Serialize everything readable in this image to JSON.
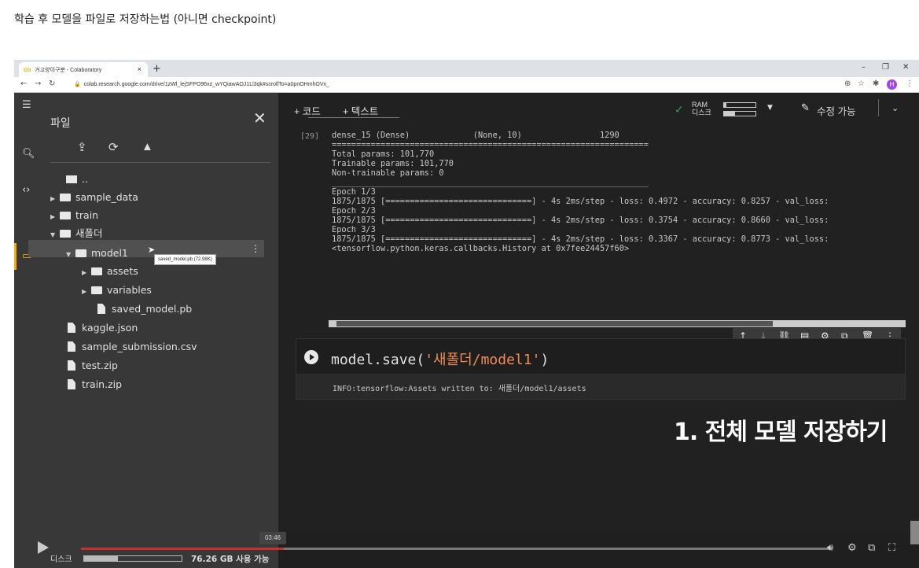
{
  "heading": "학습 후 모델을 파일로 저장하는법 (아니면 checkpoint)",
  "browser": {
    "tab_title": "거고양이구분 - Colaboratory",
    "tab_close": "×",
    "new_tab": "+",
    "url": "colab.research.google.com/drive/1zWl_lejSFPO96xz_wYQiawAOJ1Ll3qk#scrollTo=a0pnOHmhOVx_",
    "avatar": "H"
  },
  "sidebar": {
    "title": "파일",
    "close": "✕",
    "tree": [
      {
        "label": "..",
        "type": "up"
      },
      {
        "label": "sample_data",
        "type": "folder"
      },
      {
        "label": "train",
        "type": "folder"
      },
      {
        "label": "새폴더",
        "type": "folder-open"
      },
      {
        "label": "model1",
        "type": "folder-open"
      },
      {
        "label": "assets",
        "type": "folder"
      },
      {
        "label": "variables",
        "type": "folder"
      },
      {
        "label": "saved_model.pb",
        "type": "file"
      },
      {
        "label": "kaggle.json",
        "type": "file"
      },
      {
        "label": "sample_submission.csv",
        "type": "file"
      },
      {
        "label": "test.zip",
        "type": "file"
      },
      {
        "label": "train.zip",
        "type": "file"
      }
    ],
    "tooltip": "saved_model.pb (72.98K)",
    "disk_label": "디스크",
    "disk_free": "76.26 GB 사용 가능",
    "disk_used_fraction": 0.35
  },
  "toolbar": {
    "add_code": "+ 코드",
    "add_text": "+ 텍스트",
    "ram": "RAM",
    "disk": "디스크",
    "edit": "수정 가능"
  },
  "output": {
    "exec_count": "[29]",
    "lines": "dense_15 (Dense)             (None, 10)                1290\n=================================================================\nTotal params: 101,770\nTrainable params: 101,770\nNon-trainable params: 0\n_________________________________________________________________\nEpoch 1/3\n1875/1875 [==============================] - 4s 2ms/step - loss: 0.4972 - accuracy: 0.8257 - val_loss:\nEpoch 2/3\n1875/1875 [==============================] - 4s 2ms/step - loss: 0.3754 - accuracy: 0.8660 - val_loss:\nEpoch 3/3\n1875/1875 [==============================] - 4s 2ms/step - loss: 0.3367 - accuracy: 0.8773 - val_loss:\n<tensorflow.python.keras.callbacks.History at 0x7fee24457f60>"
  },
  "code_cell": {
    "code_prefix": "model.save(",
    "code_string": "'새폴더/model1'",
    "code_suffix": ")",
    "output": "INFO:tensorflow:Assets written to: 새폴더/model1/assets"
  },
  "annotation": "1. 전체 모델 저장하기",
  "video": {
    "timestamp": "03:46",
    "progress_fraction": 0.27
  },
  "colors": {
    "accent": "#f9ab00",
    "string": "#f28b54",
    "progress": "#c4302b"
  }
}
